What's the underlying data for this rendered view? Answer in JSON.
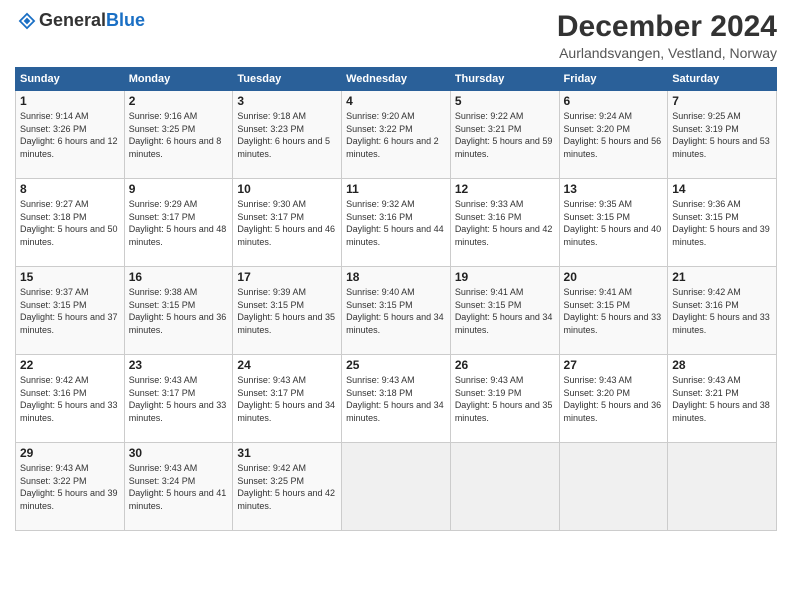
{
  "header": {
    "logo_general": "General",
    "logo_blue": "Blue",
    "title": "December 2024",
    "subtitle": "Aurlandsvangen, Vestland, Norway"
  },
  "calendar": {
    "days_of_week": [
      "Sunday",
      "Monday",
      "Tuesday",
      "Wednesday",
      "Thursday",
      "Friday",
      "Saturday"
    ],
    "weeks": [
      [
        {
          "day": "1",
          "sunrise": "Sunrise: 9:14 AM",
          "sunset": "Sunset: 3:26 PM",
          "daylight": "Daylight: 6 hours and 12 minutes."
        },
        {
          "day": "2",
          "sunrise": "Sunrise: 9:16 AM",
          "sunset": "Sunset: 3:25 PM",
          "daylight": "Daylight: 6 hours and 8 minutes."
        },
        {
          "day": "3",
          "sunrise": "Sunrise: 9:18 AM",
          "sunset": "Sunset: 3:23 PM",
          "daylight": "Daylight: 6 hours and 5 minutes."
        },
        {
          "day": "4",
          "sunrise": "Sunrise: 9:20 AM",
          "sunset": "Sunset: 3:22 PM",
          "daylight": "Daylight: 6 hours and 2 minutes."
        },
        {
          "day": "5",
          "sunrise": "Sunrise: 9:22 AM",
          "sunset": "Sunset: 3:21 PM",
          "daylight": "Daylight: 5 hours and 59 minutes."
        },
        {
          "day": "6",
          "sunrise": "Sunrise: 9:24 AM",
          "sunset": "Sunset: 3:20 PM",
          "daylight": "Daylight: 5 hours and 56 minutes."
        },
        {
          "day": "7",
          "sunrise": "Sunrise: 9:25 AM",
          "sunset": "Sunset: 3:19 PM",
          "daylight": "Daylight: 5 hours and 53 minutes."
        }
      ],
      [
        {
          "day": "8",
          "sunrise": "Sunrise: 9:27 AM",
          "sunset": "Sunset: 3:18 PM",
          "daylight": "Daylight: 5 hours and 50 minutes."
        },
        {
          "day": "9",
          "sunrise": "Sunrise: 9:29 AM",
          "sunset": "Sunset: 3:17 PM",
          "daylight": "Daylight: 5 hours and 48 minutes."
        },
        {
          "day": "10",
          "sunrise": "Sunrise: 9:30 AM",
          "sunset": "Sunset: 3:17 PM",
          "daylight": "Daylight: 5 hours and 46 minutes."
        },
        {
          "day": "11",
          "sunrise": "Sunrise: 9:32 AM",
          "sunset": "Sunset: 3:16 PM",
          "daylight": "Daylight: 5 hours and 44 minutes."
        },
        {
          "day": "12",
          "sunrise": "Sunrise: 9:33 AM",
          "sunset": "Sunset: 3:16 PM",
          "daylight": "Daylight: 5 hours and 42 minutes."
        },
        {
          "day": "13",
          "sunrise": "Sunrise: 9:35 AM",
          "sunset": "Sunset: 3:15 PM",
          "daylight": "Daylight: 5 hours and 40 minutes."
        },
        {
          "day": "14",
          "sunrise": "Sunrise: 9:36 AM",
          "sunset": "Sunset: 3:15 PM",
          "daylight": "Daylight: 5 hours and 39 minutes."
        }
      ],
      [
        {
          "day": "15",
          "sunrise": "Sunrise: 9:37 AM",
          "sunset": "Sunset: 3:15 PM",
          "daylight": "Daylight: 5 hours and 37 minutes."
        },
        {
          "day": "16",
          "sunrise": "Sunrise: 9:38 AM",
          "sunset": "Sunset: 3:15 PM",
          "daylight": "Daylight: 5 hours and 36 minutes."
        },
        {
          "day": "17",
          "sunrise": "Sunrise: 9:39 AM",
          "sunset": "Sunset: 3:15 PM",
          "daylight": "Daylight: 5 hours and 35 minutes."
        },
        {
          "day": "18",
          "sunrise": "Sunrise: 9:40 AM",
          "sunset": "Sunset: 3:15 PM",
          "daylight": "Daylight: 5 hours and 34 minutes."
        },
        {
          "day": "19",
          "sunrise": "Sunrise: 9:41 AM",
          "sunset": "Sunset: 3:15 PM",
          "daylight": "Daylight: 5 hours and 34 minutes."
        },
        {
          "day": "20",
          "sunrise": "Sunrise: 9:41 AM",
          "sunset": "Sunset: 3:15 PM",
          "daylight": "Daylight: 5 hours and 33 minutes."
        },
        {
          "day": "21",
          "sunrise": "Sunrise: 9:42 AM",
          "sunset": "Sunset: 3:16 PM",
          "daylight": "Daylight: 5 hours and 33 minutes."
        }
      ],
      [
        {
          "day": "22",
          "sunrise": "Sunrise: 9:42 AM",
          "sunset": "Sunset: 3:16 PM",
          "daylight": "Daylight: 5 hours and 33 minutes."
        },
        {
          "day": "23",
          "sunrise": "Sunrise: 9:43 AM",
          "sunset": "Sunset: 3:17 PM",
          "daylight": "Daylight: 5 hours and 33 minutes."
        },
        {
          "day": "24",
          "sunrise": "Sunrise: 9:43 AM",
          "sunset": "Sunset: 3:17 PM",
          "daylight": "Daylight: 5 hours and 34 minutes."
        },
        {
          "day": "25",
          "sunrise": "Sunrise: 9:43 AM",
          "sunset": "Sunset: 3:18 PM",
          "daylight": "Daylight: 5 hours and 34 minutes."
        },
        {
          "day": "26",
          "sunrise": "Sunrise: 9:43 AM",
          "sunset": "Sunset: 3:19 PM",
          "daylight": "Daylight: 5 hours and 35 minutes."
        },
        {
          "day": "27",
          "sunrise": "Sunrise: 9:43 AM",
          "sunset": "Sunset: 3:20 PM",
          "daylight": "Daylight: 5 hours and 36 minutes."
        },
        {
          "day": "28",
          "sunrise": "Sunrise: 9:43 AM",
          "sunset": "Sunset: 3:21 PM",
          "daylight": "Daylight: 5 hours and 38 minutes."
        }
      ],
      [
        {
          "day": "29",
          "sunrise": "Sunrise: 9:43 AM",
          "sunset": "Sunset: 3:22 PM",
          "daylight": "Daylight: 5 hours and 39 minutes."
        },
        {
          "day": "30",
          "sunrise": "Sunrise: 9:43 AM",
          "sunset": "Sunset: 3:24 PM",
          "daylight": "Daylight: 5 hours and 41 minutes."
        },
        {
          "day": "31",
          "sunrise": "Sunrise: 9:42 AM",
          "sunset": "Sunset: 3:25 PM",
          "daylight": "Daylight: 5 hours and 42 minutes."
        },
        null,
        null,
        null,
        null
      ]
    ]
  }
}
